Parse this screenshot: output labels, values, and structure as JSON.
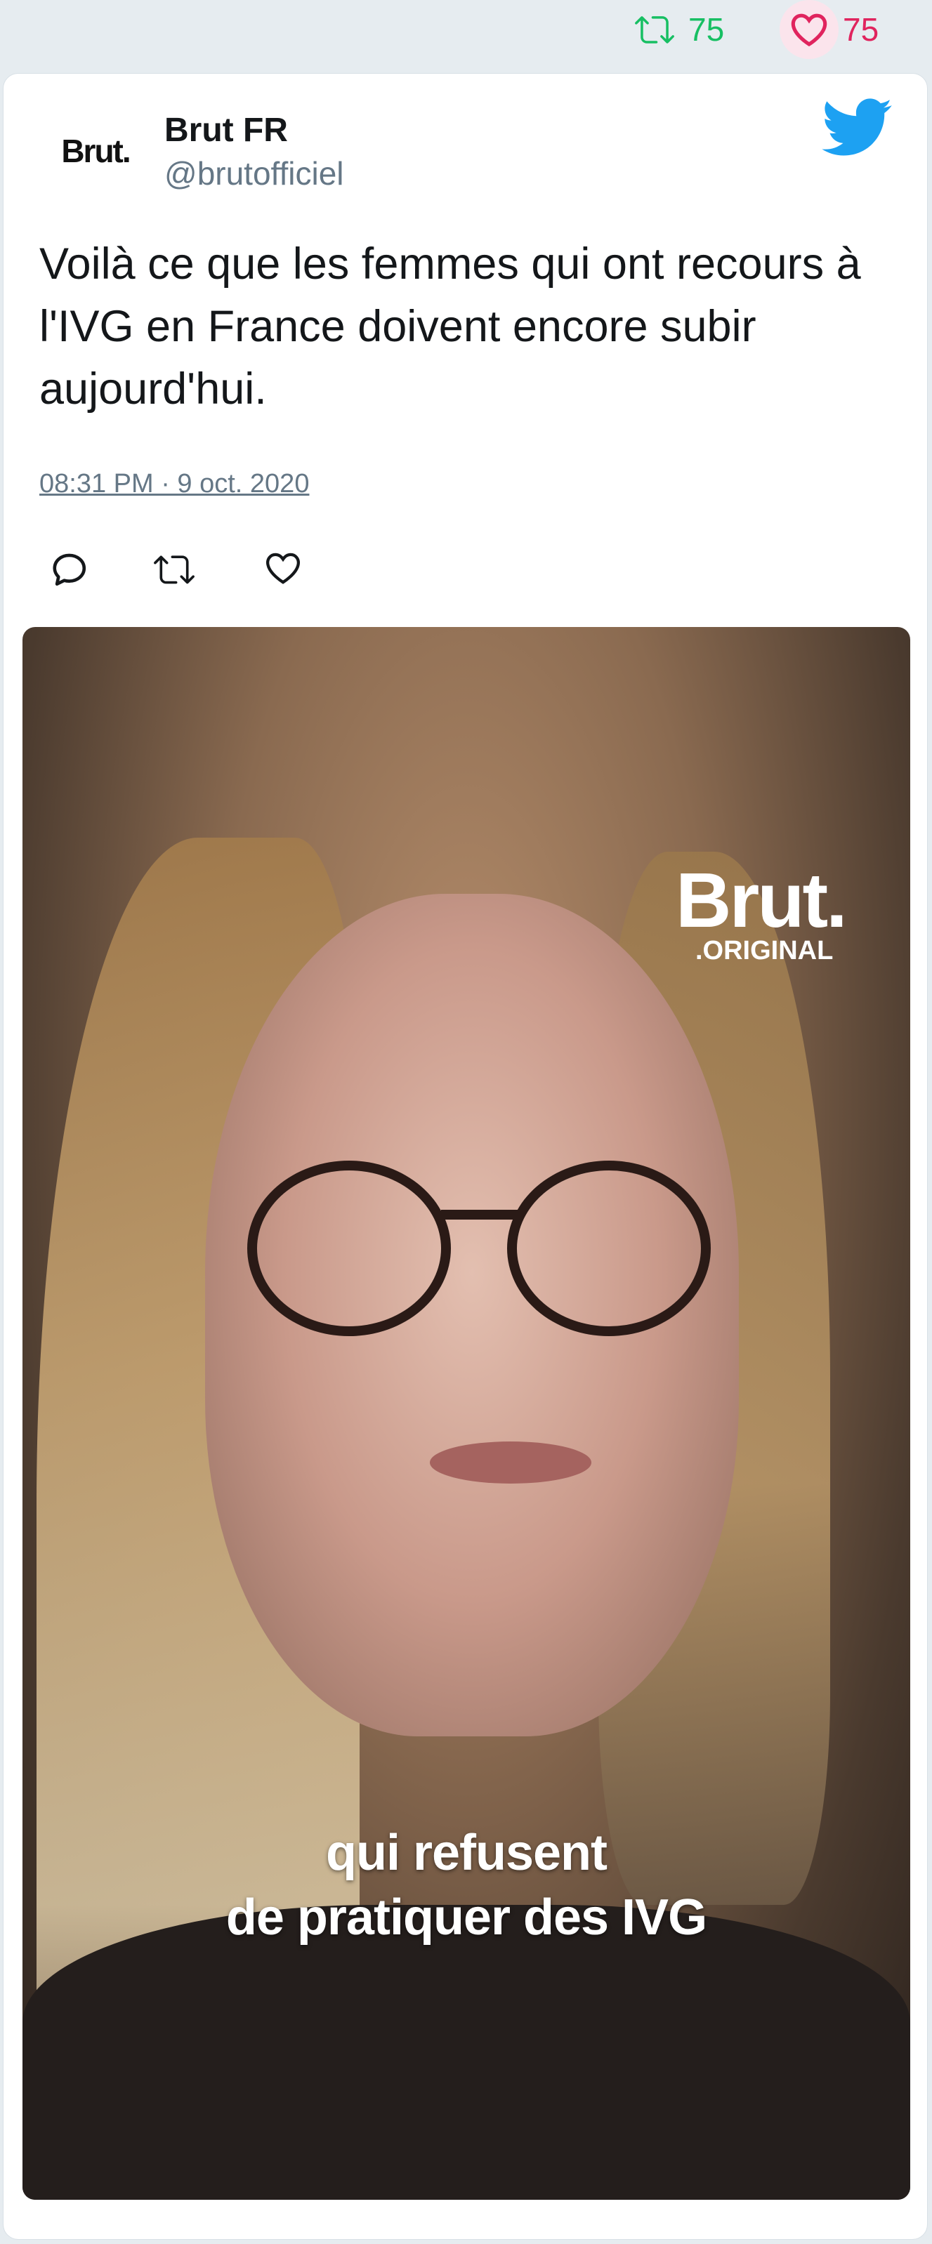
{
  "stats": {
    "retweets": "75",
    "likes": "75"
  },
  "tweet": {
    "avatar_text": "Brut.",
    "author_name": "Brut FR",
    "author_handle": "@brutofficiel",
    "text": "Voilà ce que les femmes qui ont recours à l'IVG en France doivent encore subir aujourd'hui.",
    "timestamp": "08:31 PM · 9 oct. 2020"
  },
  "media": {
    "watermark_brand": "Brut.",
    "watermark_sub": ".ORIGINAL",
    "caption_line1": "qui refusent",
    "caption_line2": "de pratiquer des IVG"
  },
  "colors": {
    "retweet": "#17bf63",
    "like": "#e0245e",
    "twitter_blue": "#1da1f2",
    "muted": "#657786"
  },
  "icons": [
    "retweet-icon",
    "heart-icon",
    "twitter-bird-icon",
    "reply-icon"
  ]
}
